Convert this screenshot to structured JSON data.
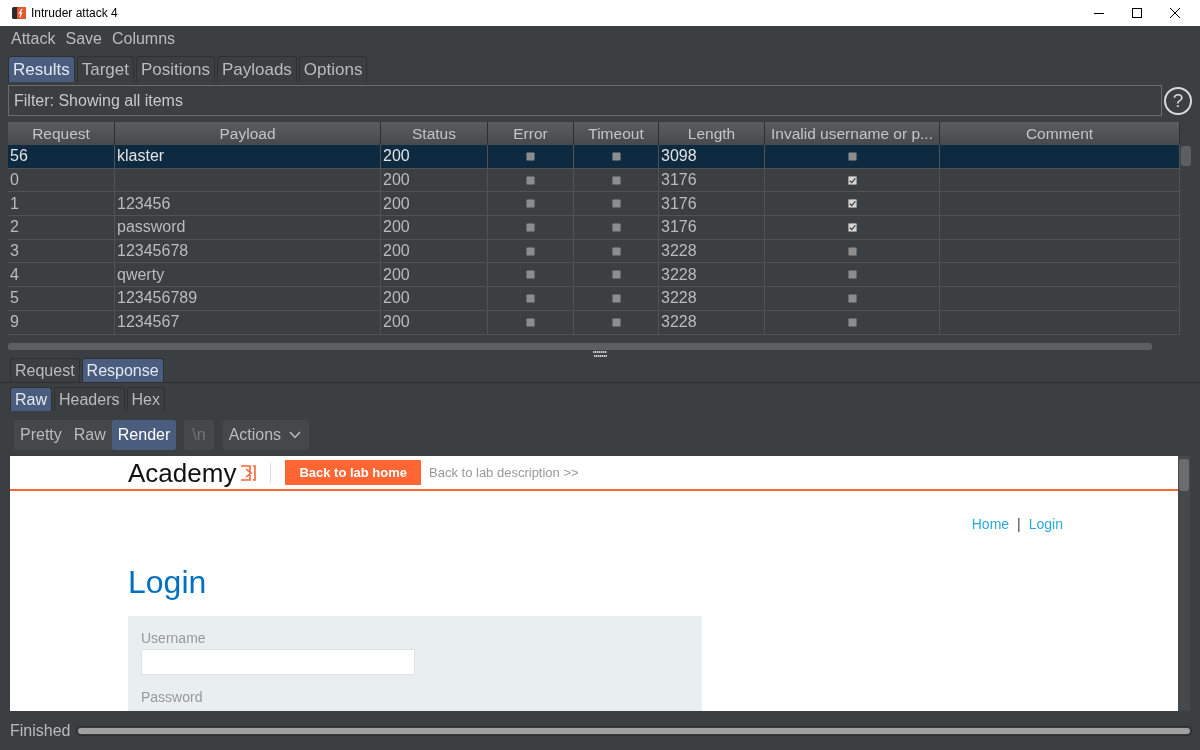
{
  "window": {
    "title": "Intruder attack 4"
  },
  "menu": [
    {
      "label": "Attack"
    },
    {
      "label": "Save"
    },
    {
      "label": "Columns"
    }
  ],
  "tabs": [
    {
      "label": "Results",
      "selected": true
    },
    {
      "label": "Target",
      "selected": false
    },
    {
      "label": "Positions",
      "selected": false
    },
    {
      "label": "Payloads",
      "selected": false
    },
    {
      "label": "Options",
      "selected": false
    }
  ],
  "filter": {
    "value": "Filter: Showing all items"
  },
  "help_button": {
    "label": "?"
  },
  "table": {
    "columns": [
      {
        "label": "Request",
        "kind": "text"
      },
      {
        "label": "Payload",
        "kind": "text"
      },
      {
        "label": "Status",
        "kind": "text"
      },
      {
        "label": "Error",
        "kind": "check"
      },
      {
        "label": "Timeout",
        "kind": "check"
      },
      {
        "label": "Length",
        "kind": "text"
      },
      {
        "label": "Invalid username or p...",
        "kind": "check"
      },
      {
        "label": "Comment",
        "kind": "text"
      }
    ],
    "rows": [
      {
        "selected": true,
        "request": "56",
        "payload": "klaster",
        "status": "200",
        "error": false,
        "timeout": false,
        "length": "3098",
        "invalid_username": false
      },
      {
        "selected": false,
        "request": "0",
        "status": "200",
        "error": false,
        "timeout": false,
        "length": "3176",
        "invalid_username": true
      },
      {
        "selected": false,
        "request": "1",
        "payload": "123456",
        "status": "200",
        "error": false,
        "timeout": false,
        "length": "3176",
        "invalid_username": true
      },
      {
        "selected": false,
        "request": "2",
        "payload": "password",
        "status": "200",
        "error": false,
        "timeout": false,
        "length": "3176",
        "invalid_username": true
      },
      {
        "selected": false,
        "request": "3",
        "payload": "12345678",
        "status": "200",
        "error": false,
        "timeout": false,
        "length": "3228",
        "invalid_username": false
      },
      {
        "selected": false,
        "request": "4",
        "payload": "qwerty",
        "status": "200",
        "error": false,
        "timeout": false,
        "length": "3228",
        "invalid_username": false
      },
      {
        "selected": false,
        "request": "5",
        "payload": "123456789",
        "status": "200",
        "error": false,
        "timeout": false,
        "length": "3228",
        "invalid_username": false
      },
      {
        "selected": false,
        "request": "9",
        "payload": "1234567",
        "status": "200",
        "error": false,
        "timeout": false,
        "length": "3228",
        "invalid_username": false
      }
    ]
  },
  "message_tabs": [
    {
      "label": "Request",
      "selected": false
    },
    {
      "label": "Response",
      "selected": true
    }
  ],
  "view_tabs": [
    {
      "label": "Raw",
      "selected": true
    },
    {
      "label": "Headers",
      "selected": false
    },
    {
      "label": "Hex",
      "selected": false
    }
  ],
  "view_modes": [
    {
      "label": "Pretty",
      "selected": false
    },
    {
      "label": "Raw",
      "selected": false
    },
    {
      "label": "Render",
      "selected": true
    }
  ],
  "newline_toggle": {
    "label": "\\n",
    "disabled": true
  },
  "actions_menu": {
    "label": "Actions"
  },
  "rendered_page": {
    "logo": "Academy",
    "back_button": "Back to lab home",
    "description_link": "Back to lab description >>",
    "nav_links": [
      {
        "label": "Home"
      },
      {
        "label": "Login"
      }
    ],
    "nav_separator": "|",
    "heading": "Login",
    "form": {
      "username_label": "Username",
      "password_label": "Password"
    }
  },
  "status_bar": {
    "text": "Finished",
    "progress": {
      "level": 1
    }
  }
}
